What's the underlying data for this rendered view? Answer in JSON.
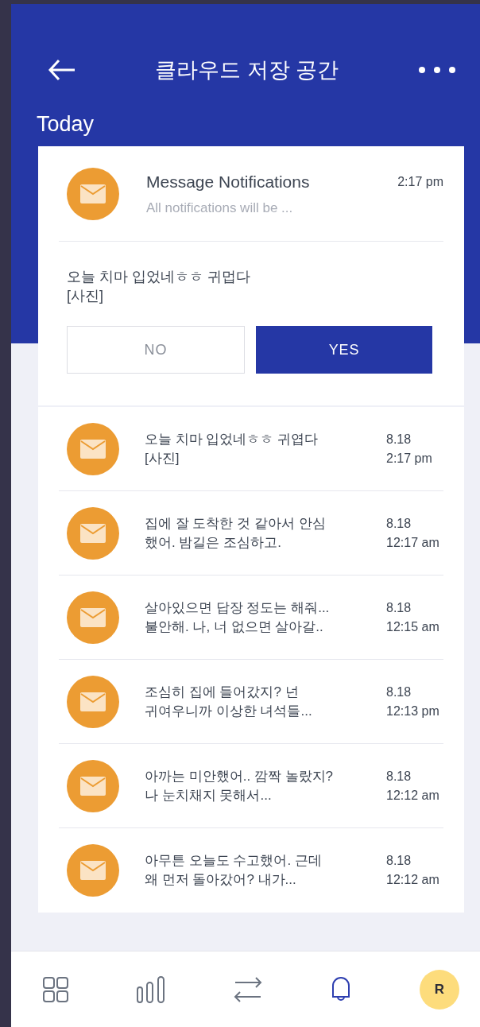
{
  "header": {
    "title": "클라우드 저장 공간"
  },
  "section_label": "Today",
  "featured": {
    "title": "Message Notifications",
    "subtitle": "All notifications will be ...",
    "time": "2:17 pm",
    "body": "오늘 치마 입었네ㅎㅎ 귀멉다\n[사진]",
    "buttons": [
      {
        "label": "NO",
        "kind": "outline"
      },
      {
        "label": "YES",
        "kind": "filled"
      }
    ]
  },
  "messages": [
    {
      "text": "오늘 치마 입었네ㅎㅎ 귀엽다\n[사진]",
      "date": "8.18",
      "time": "2:17 pm"
    },
    {
      "text": "집에 잘 도착한 것 같아서 안심\n했어. 밤길은 조심하고.",
      "date": "8.18",
      "time": "12:17 am"
    },
    {
      "text": "살아있으면 답장 정도는 해줘...\n불안해. 나, 너 없으면 살아갈..",
      "date": "8.18",
      "time": "12:15 am"
    },
    {
      "text": "조심히 집에 들어갔지? 넌\n귀여우니까 이상한 녀석들...",
      "date": "8.18",
      "time": "12:13 pm"
    },
    {
      "text": "아까는 미안했어.. 깜짝 놀랐지?\n나 눈치채지 못해서...",
      "date": "8.18",
      "time": "12:12 am"
    },
    {
      "text": "아무튼 오늘도 수고했어. 근데\n왜 먼저 돌아갔어? 내가...",
      "date": "8.18",
      "time": "12:12 am"
    }
  ],
  "nav": [
    {
      "kind": "grid",
      "selected": false
    },
    {
      "kind": "chart",
      "selected": false
    },
    {
      "kind": "swap",
      "selected": false
    },
    {
      "kind": "bell",
      "selected": true
    },
    {
      "kind": "avatar",
      "selected": false,
      "label": "R"
    }
  ]
}
